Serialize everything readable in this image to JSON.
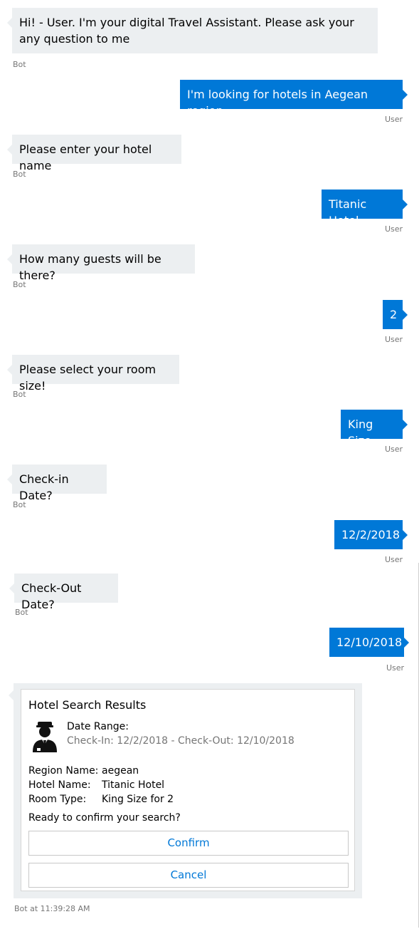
{
  "messages": [
    {
      "who": "bot",
      "text": "Hi! - User. I'm your digital Travel Assistant. Please ask your any question to me",
      "sender": "Bot"
    },
    {
      "who": "user",
      "text": "I'm looking for hotels in Aegean region",
      "sender": "User"
    },
    {
      "who": "bot",
      "text": "Please enter your hotel name",
      "sender": "Bot"
    },
    {
      "who": "user",
      "text": "Titanic Hotel",
      "sender": "User"
    },
    {
      "who": "bot",
      "text": "How many guests will be there?",
      "sender": "Bot"
    },
    {
      "who": "user",
      "text": "2",
      "sender": "User"
    },
    {
      "who": "bot",
      "text": "Please select your room size!",
      "sender": "Bot"
    },
    {
      "who": "user",
      "text": "King Size",
      "sender": "User"
    },
    {
      "who": "bot",
      "text": "Check-in Date?",
      "sender": "Bot"
    },
    {
      "who": "user",
      "text": "12/2/2018",
      "sender": "User"
    },
    {
      "who": "bot",
      "text": "Check-Out Date?",
      "sender": "Bot"
    },
    {
      "who": "user",
      "text": "12/10/2018",
      "sender": "User"
    }
  ],
  "card": {
    "title": "Hotel Search Results",
    "icon": "concierge-icon",
    "date_range_label": "Date Range:",
    "date_range_value": "Check-In: 12/2/2018 - Check-Out: 12/10/2018",
    "facts": [
      {
        "key": "Region Name:",
        "value": "aegean"
      },
      {
        "key": "Hotel Name:",
        "value": "Titanic Hotel"
      },
      {
        "key": "Room Type:",
        "value": "King Size for 2"
      }
    ],
    "question": "Ready to confirm your search?",
    "confirm_label": "Confirm",
    "cancel_label": "Cancel"
  },
  "footer": "Bot at 11:39:28 AM",
  "colors": {
    "user_bubble": "#0078d7",
    "bot_bubble": "#eceff1",
    "button_text": "#0078d7"
  }
}
